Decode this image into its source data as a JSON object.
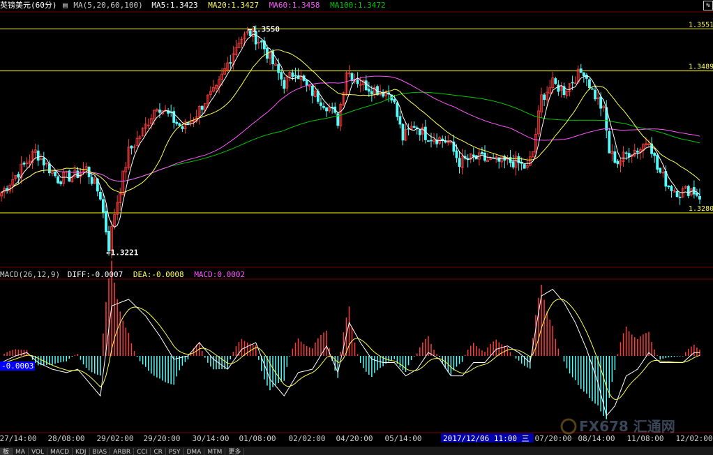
{
  "header": {
    "symbol": "英镑美元(60分)",
    "ma_label": "MA(5,20,60,100)",
    "ma5": "MA5:1.3423",
    "ma20": "MA20:1.3427",
    "ma60": "MA60:1.3458",
    "ma100": "MA100:1.3472"
  },
  "macd_header": {
    "label": "MACD(26,12,9)",
    "diff": "DIFF:-0.0007",
    "dea": "DEA:-0.0008",
    "macd": "MACD:0.0002"
  },
  "colors": {
    "up": "#ff3c3c",
    "down": "#54fcfc",
    "ma5": "#ffffff",
    "ma20": "#ffff54",
    "ma60": "#ff54ff",
    "ma100": "#00c800",
    "grid": "#7a0000",
    "hline": "#ffff00"
  },
  "tabs": [
    "板",
    "MA",
    "VOL",
    "MACD",
    "KDJ",
    "BIAS",
    "ARBR",
    "CCI",
    "CR",
    "PSY",
    "DMA",
    "MTM",
    "更多"
  ],
  "chart_data": {
    "type": "candlestick",
    "price_axis_labels": [
      "1.3551",
      "1.3489",
      "1.3280"
    ],
    "price_lines": [
      1.3551,
      1.3489,
      1.328
    ],
    "annotations": [
      {
        "text": "1.3550",
        "type": "high"
      },
      {
        "text": "1.3221",
        "type": "low"
      }
    ],
    "x_ticks": [
      "27/14:00",
      "28/08:00",
      "29/02:00",
      "29/20:00",
      "30/14:00",
      "01/08:00",
      "02/02:00",
      "04/20:00",
      "05/14:00",
      "07/20:00",
      "08/14:00",
      "11/08:00",
      "12/02:00"
    ],
    "cursor_label": "2017/12/06 11:00 三",
    "macd_current_label": "-0.0003",
    "watermark": "FX678 汇通网",
    "price_range": [
      1.3205,
      1.3575
    ],
    "close_anchors": [
      [
        0,
        1.331
      ],
      [
        12,
        1.337
      ],
      [
        20,
        1.333
      ],
      [
        26,
        1.3335
      ],
      [
        30,
        1.3345
      ],
      [
        35,
        1.3305
      ],
      [
        38,
        1.323
      ],
      [
        40,
        1.328
      ],
      [
        45,
        1.337
      ],
      [
        50,
        1.34
      ],
      [
        55,
        1.344
      ],
      [
        60,
        1.342
      ],
      [
        64,
        1.3405
      ],
      [
        68,
        1.342
      ],
      [
        72,
        1.3445
      ],
      [
        76,
        1.346
      ],
      [
        80,
        1.35
      ],
      [
        84,
        1.3535
      ],
      [
        88,
        1.3545
      ],
      [
        92,
        1.353
      ],
      [
        96,
        1.35
      ],
      [
        100,
        1.347
      ],
      [
        104,
        1.349
      ],
      [
        108,
        1.3465
      ],
      [
        112,
        1.345
      ],
      [
        116,
        1.3435
      ],
      [
        119,
        1.3415
      ],
      [
        122,
        1.349
      ],
      [
        126,
        1.3475
      ],
      [
        130,
        1.3465
      ],
      [
        134,
        1.346
      ],
      [
        138,
        1.3455
      ],
      [
        142,
        1.339
      ],
      [
        146,
        1.341
      ],
      [
        150,
        1.3395
      ],
      [
        154,
        1.339
      ],
      [
        158,
        1.3385
      ],
      [
        162,
        1.3355
      ],
      [
        166,
        1.336
      ],
      [
        170,
        1.336
      ],
      [
        174,
        1.3355
      ],
      [
        178,
        1.3355
      ],
      [
        182,
        1.3355
      ],
      [
        186,
        1.3345
      ],
      [
        188,
        1.337
      ],
      [
        191,
        1.345
      ],
      [
        195,
        1.347
      ],
      [
        199,
        1.346
      ],
      [
        203,
        1.348
      ],
      [
        206,
        1.349
      ],
      [
        209,
        1.346
      ],
      [
        213,
        1.343
      ],
      [
        215,
        1.337
      ],
      [
        218,
        1.3355
      ],
      [
        222,
        1.337
      ],
      [
        226,
        1.3375
      ],
      [
        229,
        1.339
      ],
      [
        232,
        1.3345
      ],
      [
        236,
        1.332
      ],
      [
        240,
        1.331
      ],
      [
        244,
        1.3315
      ],
      [
        247,
        1.3305
      ]
    ],
    "macd_anchors": [
      [
        0,
        -0.0002
      ],
      [
        5,
        0.0
      ],
      [
        9,
        0.0001
      ],
      [
        13,
        -0.0002
      ],
      [
        18,
        -0.0004
      ],
      [
        23,
        -0.0005
      ],
      [
        27,
        -0.0004
      ],
      [
        31,
        -0.0008
      ],
      [
        35,
        -0.0012
      ],
      [
        39,
        0.0015
      ],
      [
        45,
        0.0017
      ],
      [
        51,
        0.0012
      ],
      [
        56,
        0.0006
      ],
      [
        61,
        -0.0001
      ],
      [
        66,
        0.0
      ],
      [
        70,
        0.0004
      ],
      [
        75,
        -0.0001
      ],
      [
        80,
        -0.0004
      ],
      [
        85,
        0.0002
      ],
      [
        90,
        0.0004
      ],
      [
        95,
        -0.0007
      ],
      [
        100,
        -0.0012
      ],
      [
        105,
        -0.0005
      ],
      [
        110,
        -0.0004
      ],
      [
        115,
        0.0003
      ],
      [
        119,
        -0.0005
      ],
      [
        123,
        0.001
      ],
      [
        127,
        0.0004
      ],
      [
        131,
        -0.0001
      ],
      [
        135,
        -0.0002
      ],
      [
        139,
        -0.0002
      ],
      [
        143,
        -0.0006
      ],
      [
        147,
        -0.0004
      ],
      [
        151,
        0.0001
      ],
      [
        155,
        -0.0001
      ],
      [
        159,
        -0.0006
      ],
      [
        163,
        -0.0006
      ],
      [
        167,
        -0.0002
      ],
      [
        171,
        -0.0002
      ],
      [
        175,
        0.0002
      ],
      [
        179,
        0.0003
      ],
      [
        183,
        0.0001
      ],
      [
        187,
        -0.0002
      ],
      [
        191,
        0.0018
      ],
      [
        195,
        0.002
      ],
      [
        199,
        0.0016
      ],
      [
        203,
        0.001
      ],
      [
        207,
        0.0002
      ],
      [
        211,
        -0.0008
      ],
      [
        214,
        -0.0018
      ],
      [
        217,
        -0.0015
      ],
      [
        221,
        -0.0006
      ],
      [
        225,
        -0.0004
      ],
      [
        229,
        0.0001
      ],
      [
        233,
        -0.0002
      ],
      [
        237,
        -0.0002
      ],
      [
        241,
        -0.0002
      ],
      [
        245,
        0.0001
      ],
      [
        247,
        0.0001
      ]
    ]
  }
}
